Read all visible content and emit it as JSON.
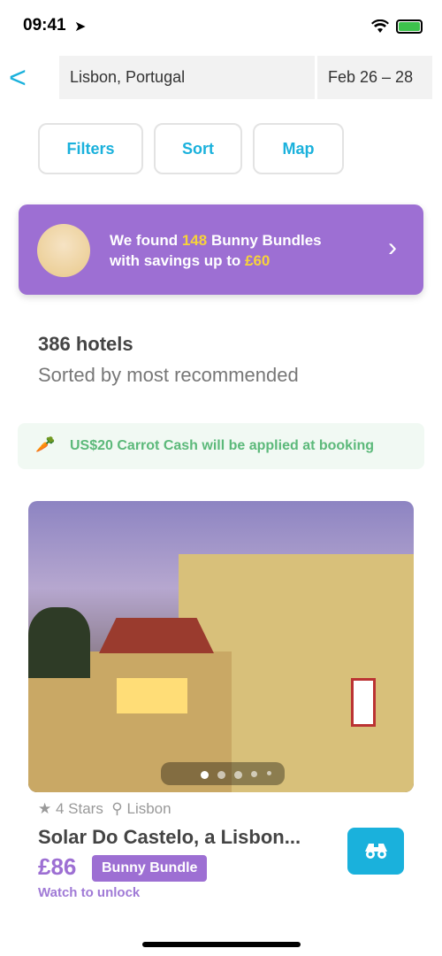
{
  "status": {
    "time": "09:41"
  },
  "header": {
    "location": "Lisbon, Portugal",
    "dates": "Feb 26 – 28"
  },
  "toolbar": {
    "filters": "Filters",
    "sort": "Sort",
    "map": "Map"
  },
  "banner": {
    "pre": "We found ",
    "count": "148",
    "mid": " Bunny Bundles",
    "line2": "with savings up to ",
    "savings": "£60"
  },
  "results": {
    "count": "386 hotels",
    "sort_desc": "Sorted by most recommended"
  },
  "promo": {
    "text": "US$20 Carrot Cash will be applied at booking"
  },
  "hotel": {
    "stars": "4 Stars",
    "city": "Lisbon",
    "name": "Solar Do Castelo, a Lisbon...",
    "price": "£86",
    "badge": "Bunny Bundle",
    "unlock": "Watch to unlock",
    "photo_count": 5,
    "photo_index": 1
  },
  "colors": {
    "accent": "#1ab1dc",
    "purple": "#9d6fd3",
    "yellow": "#f7d33a",
    "green": "#5cb97a"
  }
}
